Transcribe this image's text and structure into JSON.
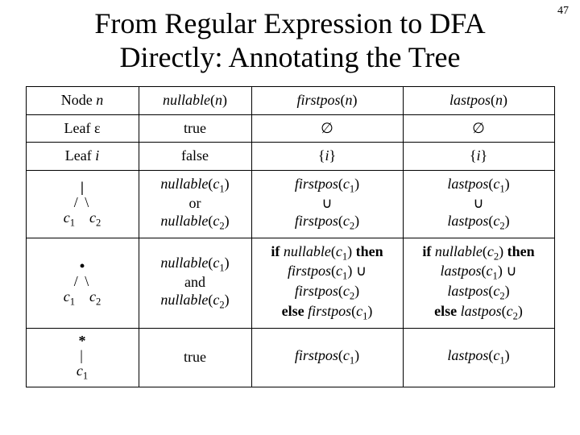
{
  "page": "47",
  "title": {
    "line1": "From Regular Expression to DFA",
    "line2": "Directly: Annotating the Tree"
  },
  "head": {
    "node_word": "Node",
    "n": "n",
    "nullable": "nullable",
    "firstpos": "firstpos",
    "lastpos": "lastpos"
  },
  "sym": {
    "c": "c",
    "union": "∪",
    "if": "if",
    "then": "then",
    "else": "else"
  },
  "rows": [
    {
      "node": {
        "a": "Leaf",
        "b": "ε"
      },
      "nullable": "true",
      "firstpos": "∅",
      "lastpos": "∅"
    },
    {
      "node": {
        "a": "Leaf",
        "b": "i"
      },
      "nullable": "false",
      "i": "i"
    },
    {
      "tree": {
        "op": "|",
        "branches": "/  \\"
      },
      "nullconj": "or"
    },
    {
      "tree": {
        "op": "•",
        "branches": "/  \\"
      },
      "nullconj": "and"
    },
    {
      "tree": {
        "op": "*",
        "branches": "|"
      },
      "nullable": "true"
    }
  ]
}
